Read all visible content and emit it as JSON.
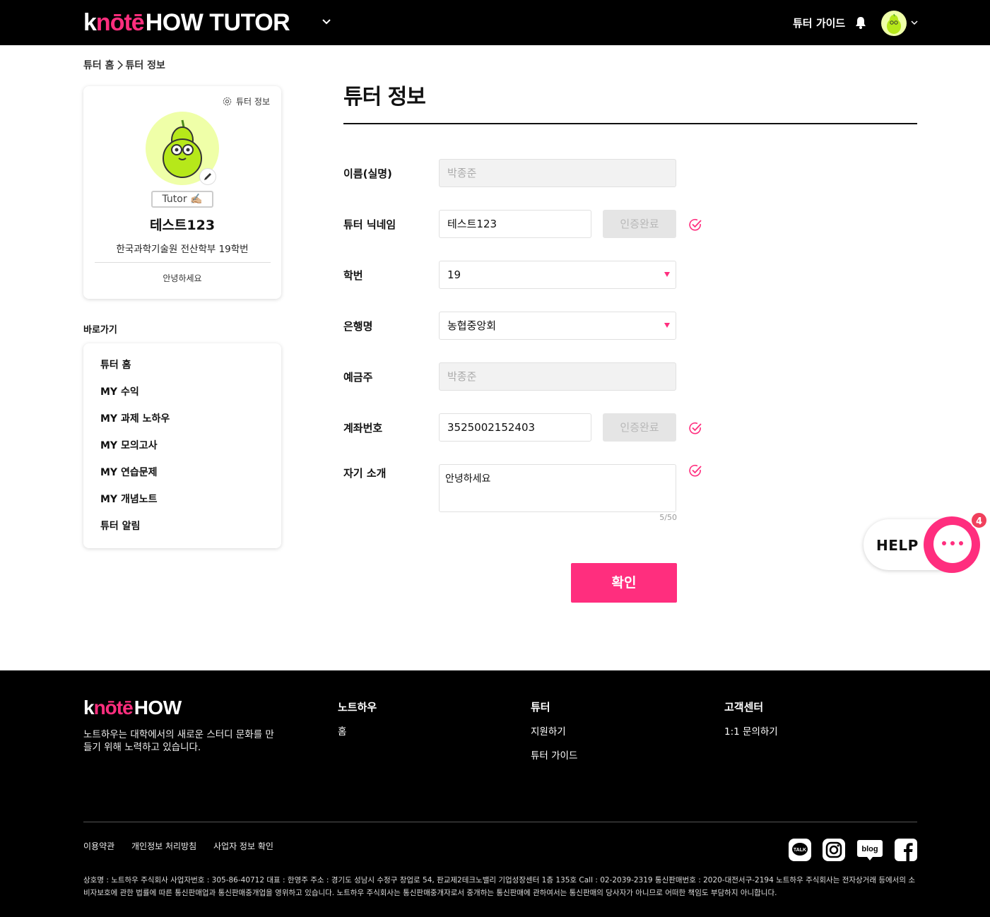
{
  "header": {
    "brand_k": "k",
    "brand_note": "nōtē",
    "brand_how": "HOW TUTOR",
    "guide": "튜터 가이드"
  },
  "breadcrumb": [
    "튜터 홈",
    "튜터 정보"
  ],
  "profile": {
    "settings_label": "튜터 정보",
    "role": "Tutor ✍🏼",
    "name": "테스트123",
    "school": "한국과학기술원 전산학부 19학번",
    "intro": "안녕하세요"
  },
  "shortcuts": {
    "title": "바로가기",
    "items": [
      "튜터 홈",
      "MY 수익",
      "MY 과제 노하우",
      "MY 모의고사",
      "MY 연습문제",
      "MY 개념노트",
      "튜터 알림"
    ]
  },
  "form": {
    "title": "튜터 정보",
    "rows": [
      {
        "label": "이름(실명)",
        "value": "박종준"
      },
      {
        "label": "튜터 닉네임",
        "value": "테스트123",
        "button": "인증완료"
      },
      {
        "label": "학번",
        "value": "19"
      },
      {
        "label": "은행명",
        "value": "농협중앙회"
      },
      {
        "label": "예금주",
        "value": "박종준"
      },
      {
        "label": "계좌번호",
        "value": "3525002152403",
        "button": "인증완료"
      },
      {
        "label": "자기 소개",
        "value": "안녕하세요"
      }
    ],
    "counter": "5/50",
    "submit": "확인"
  },
  "help": {
    "label": "HELP",
    "badge": "4"
  },
  "footer": {
    "brand_k": "k",
    "brand_note": "nōtē",
    "brand_how": "HOW",
    "desc": "노트하우는 대학에서의 새로운 스터디 문화를 만들기 위해 노력하고 있습니다.",
    "cols": [
      {
        "title": "노트하우",
        "links": [
          "홈"
        ]
      },
      {
        "title": "튜터",
        "links": [
          "지원하기",
          "튜터 가이드"
        ]
      },
      {
        "title": "고객센터",
        "links": [
          "1:1 문의하기"
        ]
      }
    ],
    "policies": [
      "이용약관",
      "개인정보 처리방침",
      "사업자 정보 확인"
    ],
    "legal": "상호명 : 노트하우 주식회사 사업자번호 : 305-86-40712 대표 : 한영주 주소 : 경기도 성남시 수정구 창업로 54, 판교제2테크노밸리 기업성장센터 1층 135호 Call : 02-2039-2319 통신판매번호 : 2020-대전서구-2194 노트하우 주식회사는 전자상거래 등에서의 소비자보호에 관한 법률에 따른 통신판매업과 통신판매중개업을 영위하고 있습니다. 노트하우 주식회사는 통신판매중개자로서 중개하는 통신판매에 관하여서는 통신판매의 당사자가 아니므로 어떠한 책임도 부담하지 아니합니다.",
    "social": [
      "kakao-talk-icon",
      "instagram-icon",
      "blog-icon",
      "facebook-icon"
    ]
  },
  "colors": {
    "accent": "#ff2e7e",
    "header_bg": "#000000",
    "avatar_bg": "#efffa8"
  }
}
